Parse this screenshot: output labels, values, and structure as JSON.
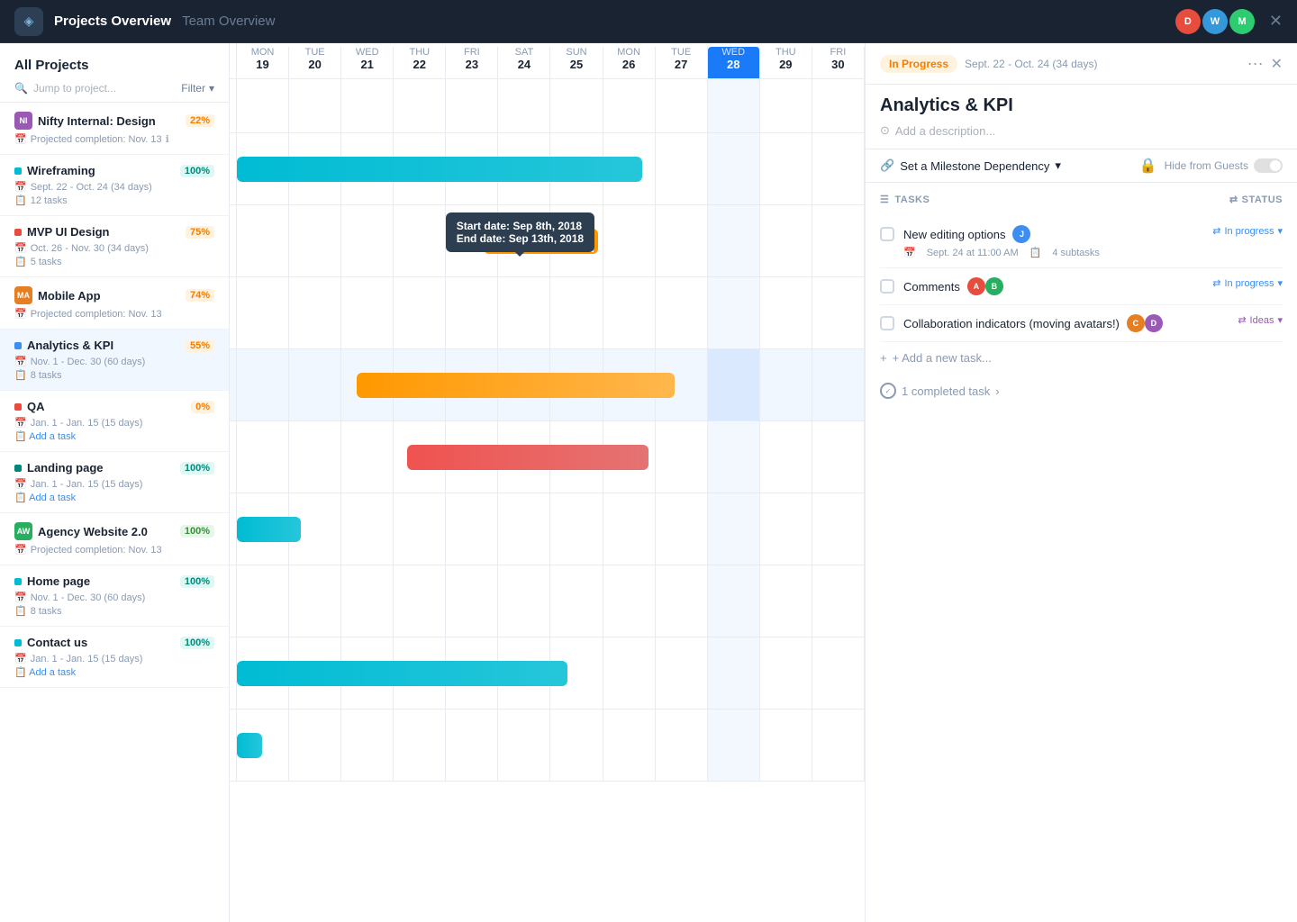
{
  "topbar": {
    "logo_icon": "◈",
    "title": "Projects Overview",
    "team": "Team Overview",
    "avatars": [
      {
        "label": "D",
        "class": "avatar-d"
      },
      {
        "label": "W",
        "class": "avatar-w"
      },
      {
        "label": "M",
        "class": "avatar-m"
      }
    ]
  },
  "sidebar": {
    "title": "All Projects",
    "search_placeholder": "Jump to project...",
    "filter_label": "Filter",
    "projects": [
      {
        "id": "ni",
        "badge_text": "NI",
        "badge_color": "#9b59b6",
        "name": "Nifty Internal: Design",
        "pct": "22%",
        "pct_class": "pct-orange",
        "meta": "Projected completion: Nov. 13",
        "tasks": null,
        "add_task": null
      },
      {
        "id": "wireframing",
        "badge_text": "",
        "badge_color": "#00bcd4",
        "name": "Wireframing",
        "pct": "100%",
        "pct_class": "pct-teal",
        "meta": "Sept. 22 - Oct. 24 (34 days)",
        "tasks": "12 tasks",
        "add_task": null
      },
      {
        "id": "mvp",
        "badge_text": "",
        "badge_color": "#e74c3c",
        "name": "MVP UI Design",
        "pct": "75%",
        "pct_class": "pct-orange",
        "meta": "Oct. 26 - Nov. 30 (34 days)",
        "tasks": "5 tasks",
        "add_task": null
      },
      {
        "id": "mobile",
        "badge_text": "MA",
        "badge_color": "#e67e22",
        "name": "Mobile App",
        "pct": "74%",
        "pct_class": "pct-orange",
        "meta": "Projected completion: Nov. 13",
        "tasks": null,
        "add_task": null
      },
      {
        "id": "analytics",
        "badge_text": "",
        "badge_color": "#3d8ef0",
        "name": "Analytics & KPI",
        "pct": "55%",
        "pct_class": "pct-orange",
        "meta": "Nov. 1 - Dec. 30 (60 days)",
        "tasks": "8 tasks",
        "add_task": null
      },
      {
        "id": "qa",
        "badge_text": "",
        "badge_color": "#e74c3c",
        "name": "QA",
        "pct": "0%",
        "pct_class": "pct-orange",
        "meta": "Jan. 1 - Jan. 15 (15 days)",
        "tasks": null,
        "add_task": "Add a task"
      },
      {
        "id": "landing",
        "badge_text": "",
        "badge_color": "#00897b",
        "name": "Landing page",
        "pct": "100%",
        "pct_class": "pct-teal",
        "meta": "Jan. 1 - Jan. 15 (15 days)",
        "tasks": null,
        "add_task": "Add a task"
      },
      {
        "id": "agency",
        "badge_text": "AW",
        "badge_color": "#27ae60",
        "name": "Agency Website 2.0",
        "pct": "100%",
        "pct_class": "pct-green",
        "meta": "Projected completion: Nov. 13",
        "tasks": null,
        "add_task": null
      },
      {
        "id": "homepage",
        "badge_text": "",
        "badge_color": "#00bcd4",
        "name": "Home page",
        "pct": "100%",
        "pct_class": "pct-teal",
        "meta": "Nov. 1 - Dec. 30 (60 days)",
        "tasks": "8 tasks",
        "add_task": null
      },
      {
        "id": "contact",
        "badge_text": "",
        "badge_color": "#00bcd4",
        "name": "Contact us",
        "pct": "100%",
        "pct_class": "pct-teal",
        "meta": "Jan. 1 - Jan. 15 (15 days)",
        "tasks": null,
        "add_task": "Add a task"
      }
    ]
  },
  "gantt": {
    "days": [
      {
        "name": "MON",
        "num": "19"
      },
      {
        "name": "TUE",
        "num": "20"
      },
      {
        "name": "WED",
        "num": "21"
      },
      {
        "name": "THU",
        "num": "22"
      },
      {
        "name": "FRI",
        "num": "23"
      },
      {
        "name": "SAT",
        "num": "24"
      },
      {
        "name": "SUN",
        "num": "25"
      },
      {
        "name": "MON",
        "num": "26"
      },
      {
        "name": "TUE",
        "num": "27"
      },
      {
        "name": "WED",
        "num": "28",
        "today": true
      },
      {
        "name": "THU",
        "num": "29"
      },
      {
        "name": "FRI",
        "num": "30"
      }
    ],
    "tooltip": {
      "start_label": "Start date:",
      "start_value": "Sep 8th, 2018",
      "end_label": "End date:",
      "end_value": "Sep 13th, 2018"
    }
  },
  "panel": {
    "status_badge": "In Progress",
    "date_range": "Sept. 22 - Oct. 24 (34 days)",
    "title": "Analytics & KPI",
    "desc_placeholder": "Add a description...",
    "milestone_label": "Set a Milestone Dependency",
    "hide_guests_label": "Hide from Guests",
    "tasks_label": "TASKS",
    "status_col_label": "STATUS",
    "tasks": [
      {
        "name": "New editing options",
        "has_avatar": true,
        "avatar_color": "#3d8ef0",
        "avatar_label": "J",
        "date": "Sept. 24 at 11:00 AM",
        "subtasks": "4 subtasks",
        "status": "In progress",
        "status_class": "task-status"
      },
      {
        "name": "Comments",
        "has_avatar": true,
        "avatar_color": "#e74c3c",
        "avatar_label": "A",
        "avatar2_color": "#27ae60",
        "avatar2_label": "B",
        "date": null,
        "subtasks": null,
        "status": "In progress",
        "status_class": "task-status"
      },
      {
        "name": "Collaboration indicators (moving avatars!)",
        "has_avatar": true,
        "avatar_color": "#e67e22",
        "avatar_label": "C",
        "avatar2_color": "#9b59b6",
        "avatar2_label": "D",
        "date": null,
        "subtasks": null,
        "status": "Ideas",
        "status_class": "task-status task-status-ideas"
      }
    ],
    "add_task_label": "+ Add a new task...",
    "completed_task_label": "1 completed task"
  }
}
